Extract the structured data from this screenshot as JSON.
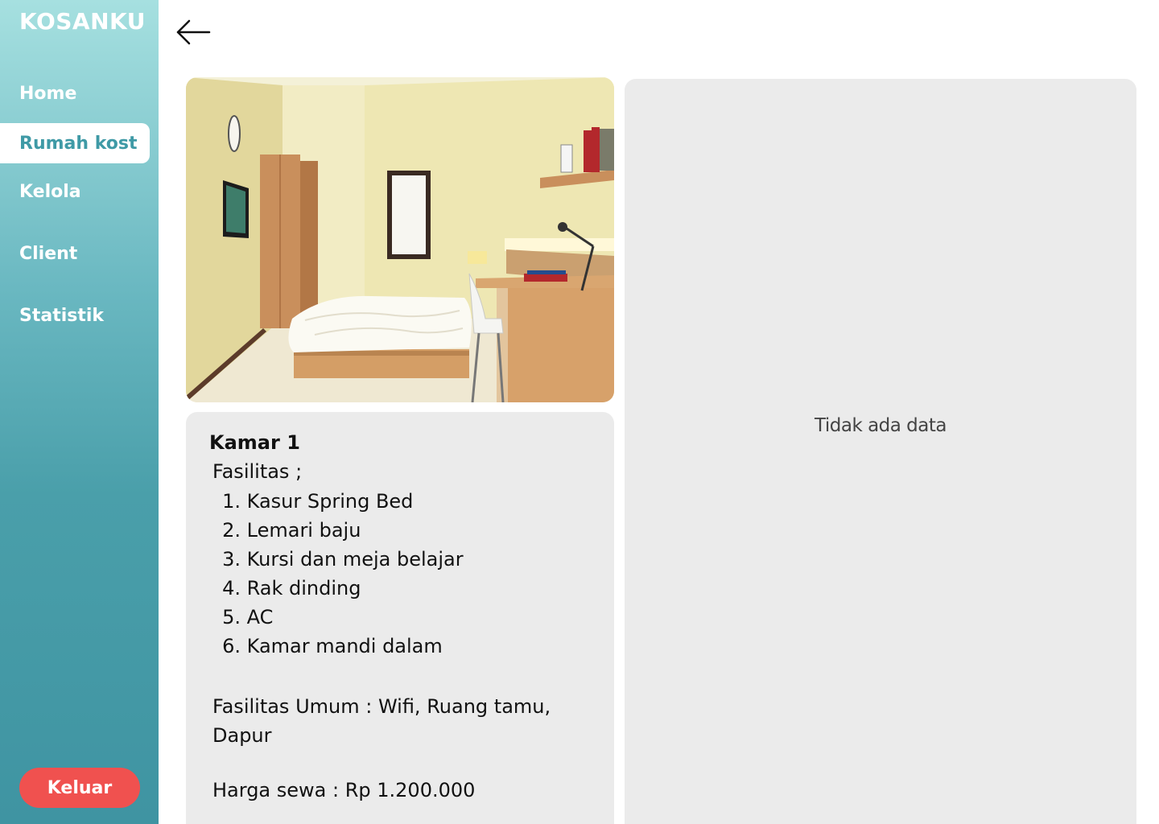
{
  "sidebar": {
    "brand": "KOSANKU",
    "items": [
      {
        "label": "Home"
      },
      {
        "label": "Rumah kost"
      },
      {
        "label": "Kelola"
      },
      {
        "label": "Client"
      },
      {
        "label": "Statistik"
      }
    ],
    "active": "Rumah kost",
    "logout_label": "Keluar"
  },
  "header": {
    "back_icon": "arrow-left-icon"
  },
  "room": {
    "title": "Kamar 1",
    "facilities_heading": "Fasilitas ;",
    "facilities": [
      {
        "num": "1.",
        "text": "Kasur Spring Bed"
      },
      {
        "num": "2.",
        "text": "Lemari baju"
      },
      {
        "num": "3.",
        "text": "Kursi dan meja belajar"
      },
      {
        "num": "4.",
        "text": "Rak dinding"
      },
      {
        "num": "5.",
        "text": "AC"
      },
      {
        "num": "6.",
        "text": "Kamar mandi dalam"
      }
    ],
    "general_facilities": "Fasilitas Umum : Wifi, Ruang tamu, Dapur",
    "price": "Harga sewa : Rp 1.200.000"
  },
  "panel": {
    "empty_text": "Tidak ada data"
  },
  "colors": {
    "accent": "#3f9aa6",
    "logout": "#f0514f",
    "card": "#ebebeb"
  }
}
